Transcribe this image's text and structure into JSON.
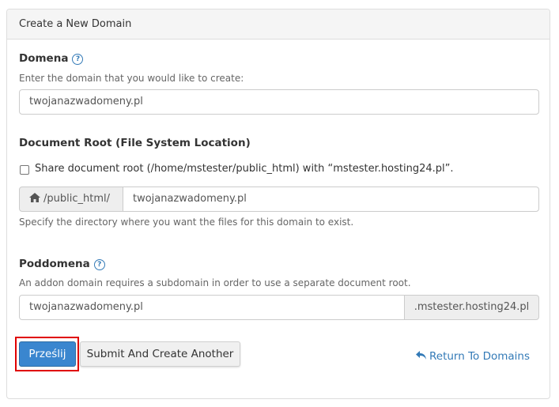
{
  "panel": {
    "title": "Create a New Domain"
  },
  "domain": {
    "label": "Domena",
    "hint": "Enter the domain that you would like to create:",
    "value": "twojanazwadomeny.pl"
  },
  "docroot": {
    "label": "Document Root (File System Location)",
    "share_label": "Share document root (/home/mstester/public_html) with “mstester.hosting24.pl”.",
    "share_checked": false,
    "prefix": "/public_html/",
    "value": "twojanazwadomeny.pl",
    "hint": "Specify the directory where you want the files for this domain to exist."
  },
  "subdomain": {
    "label": "Poddomena",
    "hint": "An addon domain requires a subdomain in order to use a separate document root.",
    "value": "twojanazwadomeny.pl",
    "suffix": ".mstester.hosting24.pl"
  },
  "actions": {
    "submit_label": "Prześlij",
    "submit_another_label": "Submit And Create Another",
    "return_label": "Return To Domains"
  },
  "colors": {
    "primary": "#3a86cf",
    "link": "#337ab7",
    "highlight": "#e00000"
  }
}
